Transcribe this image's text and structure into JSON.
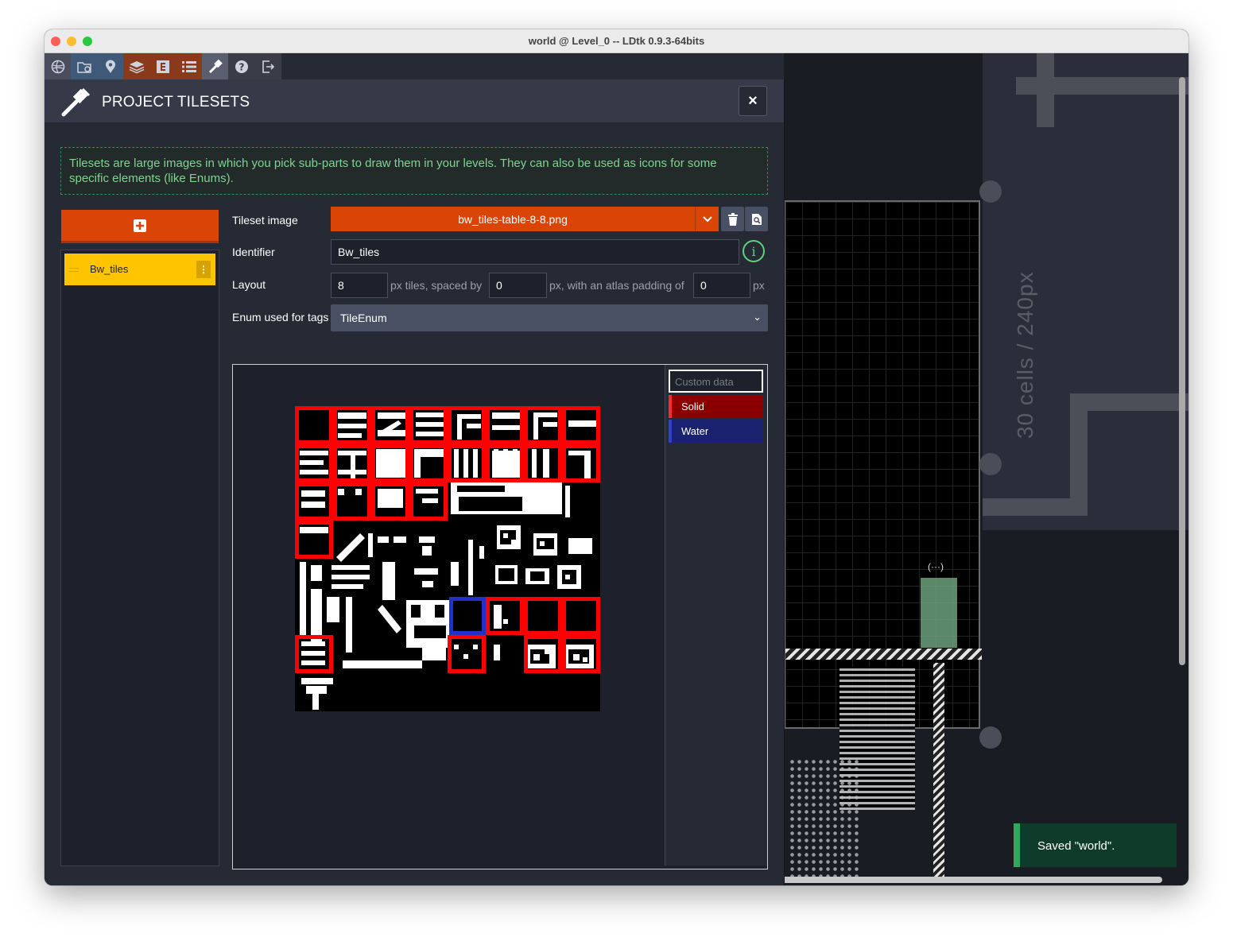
{
  "window": {
    "title": "world  @ Level_0   --   LDtk 0.9.3-64bits"
  },
  "toolbar": {
    "icons": [
      "world-icon",
      "project-settings-icon",
      "location-icon",
      "layers-icon",
      "entities-icon",
      "enums-icon",
      "tilesets-icon",
      "help-icon",
      "exit-icon"
    ]
  },
  "panel": {
    "title": "PROJECT TILESETS",
    "close_label": "×",
    "info": "Tilesets are large images in which you pick sub-parts to draw them in your levels. They can also be used as icons for some specific elements (like Enums)."
  },
  "sidebar": {
    "add_label": "+",
    "items": [
      {
        "label": "Bw_tiles",
        "menu_label": "⋮"
      }
    ]
  },
  "form": {
    "tileset_image_label": "Tileset image",
    "tileset_image_file": "bw_tiles-table-8-8.png",
    "identifier_label": "Identifier",
    "identifier_value": "Bw_tiles",
    "layout_label": "Layout",
    "tile_size": "8",
    "text_px_tiles": "px tiles, spaced by",
    "spacing": "0",
    "text_atlas_padding": "px, with an atlas padding of",
    "padding": "0",
    "text_px": "px",
    "enum_label": "Enum used for tags",
    "enum_value": "TileEnum",
    "info_icon": "i"
  },
  "custom_data": {
    "placeholder": "Custom data",
    "tags": [
      {
        "label": "Solid",
        "color": "#8a0000"
      },
      {
        "label": "Water",
        "color": "#1a2270"
      }
    ]
  },
  "editor": {
    "level_size_label": "30 cells / 240px"
  },
  "toast": {
    "message": "Saved \"world\"."
  },
  "colors": {
    "accent": "#db4407",
    "selected": "#ffc400",
    "success": "#2fa85b"
  }
}
